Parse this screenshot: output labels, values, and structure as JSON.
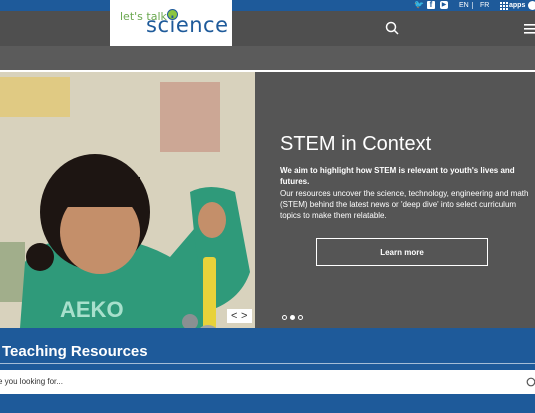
{
  "topbar": {
    "social": [
      "twitter-icon",
      "facebook-icon",
      "youtube-icon"
    ],
    "lang_en": "EN",
    "lang_fr": "FR",
    "apps_label": "apps"
  },
  "logo": {
    "line1": "let's talk",
    "line2": "science"
  },
  "hero": {
    "title": "STEM in Context",
    "lead": "We aim to highlight how STEM is relevant to youth's lives and futures.",
    "body": "Our resources uncover the science, technology, engineering and math (STEM) behind the latest news or 'deep dive' into select curriculum topics to make them relatable.",
    "cta": "Learn more",
    "arrow_prev": "<",
    "arrow_next": ">"
  },
  "teaching": {
    "title": "Teaching Resources",
    "search_placeholder": "e you looking for..."
  },
  "colors": {
    "brand_blue": "#1e5a9a",
    "header_gray": "#4f4f4f",
    "hero_gray": "#555555",
    "logo_green": "#6aa84f"
  }
}
